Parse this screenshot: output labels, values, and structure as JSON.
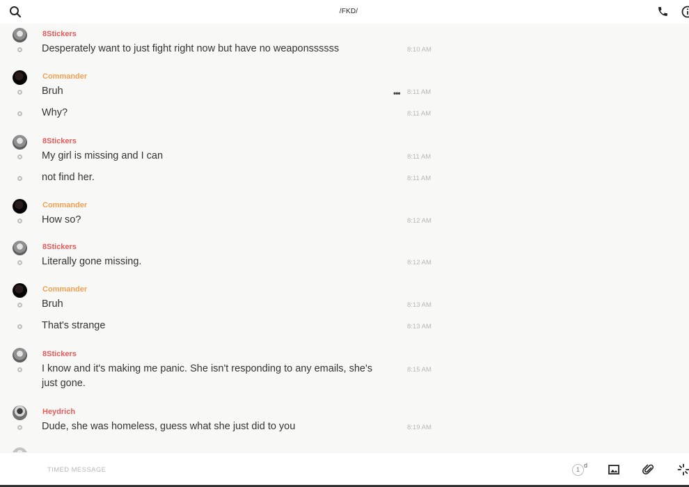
{
  "topbar": {
    "title": "/FKD/"
  },
  "messages": [
    {
      "author": "8Stickers",
      "author_color": "#e55b5b",
      "avatar": "gray",
      "lines": [
        {
          "text": "Desperately want to just fight right now but have no weaponssssss",
          "time": "8:10 AM"
        }
      ]
    },
    {
      "author": "Commander",
      "author_color": "#f2a052",
      "avatar": "black",
      "lines": [
        {
          "text": "Bruh",
          "time": "8:11 AM",
          "menu": "•••"
        },
        {
          "text": "Why?",
          "time": "8:11 AM"
        }
      ]
    },
    {
      "author": "8Stickers",
      "author_color": "#e55b5b",
      "avatar": "gray",
      "lines": [
        {
          "text": "My girl is missing and I can",
          "time": "8:11 AM"
        },
        {
          "text": "not find her.",
          "time": "8:11 AM"
        }
      ]
    },
    {
      "author": "Commander",
      "author_color": "#f2a052",
      "avatar": "black",
      "lines": [
        {
          "text": "How so?",
          "time": "8:12 AM"
        }
      ]
    },
    {
      "author": "8Stickers",
      "author_color": "#e55b5b",
      "avatar": "gray",
      "lines": [
        {
          "text": "Literally gone missing.",
          "time": "8:12 AM"
        }
      ]
    },
    {
      "author": "Commander",
      "author_color": "#f2a052",
      "avatar": "black",
      "lines": [
        {
          "text": "Bruh",
          "time": "8:13 AM"
        },
        {
          "text": "That's strange",
          "time": "8:13 AM"
        }
      ]
    },
    {
      "author": "8Stickers",
      "author_color": "#e55b5b",
      "avatar": "gray",
      "lines": [
        {
          "text": "I know and it's making me panic. She isn't responding to any emails, she's just gone.",
          "time": "8:15 AM"
        }
      ]
    },
    {
      "author": "Heydrich",
      "author_color": "#e55b5b",
      "avatar": "photo",
      "lines": [
        {
          "text": "Dude, she was homeless, guess what she just did to you",
          "time": "8:19 AM"
        }
      ]
    }
  ],
  "composer": {
    "placeholder": "TIMED MESSAGE",
    "timer_value": "1",
    "timer_unit": "d"
  },
  "icons": {
    "search": "search-icon",
    "call": "phone-icon",
    "info": "info-icon",
    "image": "image-icon",
    "attach": "paperclip-icon",
    "effects": "sparkle-icon"
  }
}
